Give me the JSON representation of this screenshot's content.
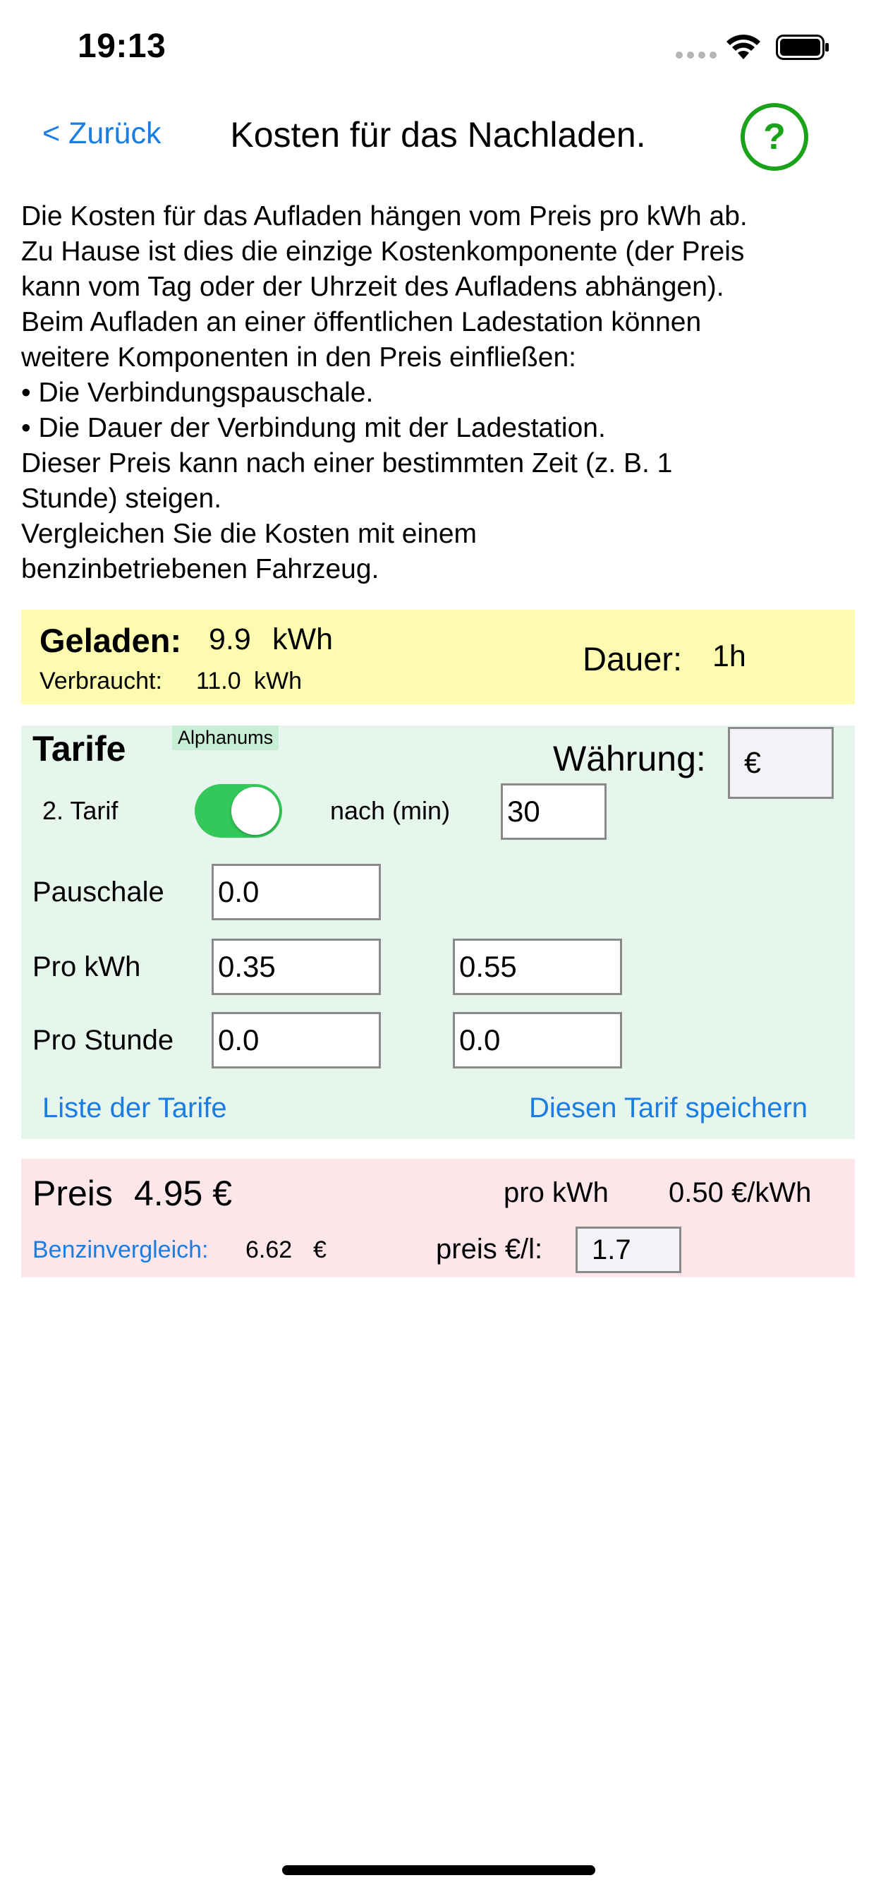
{
  "status_bar": {
    "time": "19:13"
  },
  "nav": {
    "back_label": "< Zurück",
    "title": "Kosten für das Nachladen.",
    "help_label": "?"
  },
  "intro": {
    "lines": [
      "Die Kosten für das Aufladen hängen vom Preis pro kWh ab.",
      "Zu Hause ist dies die einzige Kostenkomponente (der Preis",
      "kann vom Tag oder der Uhrzeit des Aufladens abhängen).",
      "Beim Aufladen an einer öffentlichen Ladestation können",
      "weitere Komponenten in den Preis einfließen:",
      "• Die Verbindungspauschale.",
      "• Die Dauer der Verbindung mit der Ladestation.",
      "Dieser Preis kann nach einer bestimmten Zeit (z. B. 1",
      "Stunde) steigen.",
      "Vergleichen Sie die Kosten mit einem",
      "benzinbetriebenen Fahrzeug."
    ]
  },
  "charge": {
    "charged_label": "Geladen:",
    "charged_value": "9.9",
    "charged_unit": "kWh",
    "used_label": "Verbraucht:",
    "used_value": "11.0",
    "used_unit": "kWh",
    "duration_label": "Dauer:",
    "duration_value": "1h"
  },
  "tariff": {
    "title": "Tarife",
    "badge": "Alphanums",
    "currency_label": "Währung:",
    "currency_value": "€",
    "second_tariff_label": "2. Tarif",
    "second_tariff_enabled": true,
    "after_label": "nach (min)",
    "after_value": "30",
    "flat_label": "Pauschale",
    "flat_value": "0.0",
    "per_kwh_label": "Pro kWh",
    "per_kwh_value_1": "0.35",
    "per_kwh_value_2": "0.55",
    "per_hour_label": "Pro Stunde",
    "per_hour_value_1": "0.0",
    "per_hour_value_2": "0.0",
    "list_link": "Liste der Tarife",
    "save_link": "Diesen Tarif speichern"
  },
  "price": {
    "label": "Preis",
    "value": "4.95 €",
    "per_kwh_label": "pro kWh",
    "per_kwh_value": "0.50 €/kWh",
    "fuel_compare_label": "Benzinvergleich:",
    "fuel_compare_value": "6.62",
    "fuel_compare_unit": "€",
    "fuel_price_label": "preis €/l:",
    "fuel_price_value": "1.7"
  },
  "colors": {
    "link": "#1a7de2",
    "help_green": "#1aa31a",
    "charge_bg": "#fdfbb0",
    "tariff_bg": "#e7f6ec",
    "price_bg": "#fde6ea",
    "toggle_on": "#34c759"
  }
}
